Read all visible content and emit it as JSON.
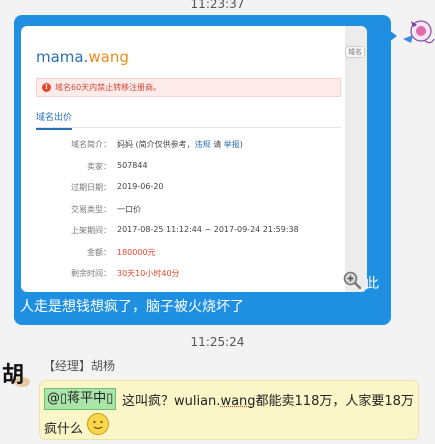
{
  "timestamps": [
    "11:23:37",
    "11:25:24"
  ],
  "message1": {
    "screenshot": {
      "brand_part1": "mama.",
      "brand_part2": "wang",
      "tab_stub": "域名",
      "warning": "域名60天内禁止转移注册商。",
      "subtab": "域名出价",
      "rows": [
        {
          "label": "域名简介：",
          "value": "妈妈 (简介仅供参考，",
          "link1": "违规",
          "mid": " 请 ",
          "link2": "举报",
          "end": ")"
        },
        {
          "label": "卖家：",
          "value": "507844"
        },
        {
          "label": "过期日期：",
          "value": "2019-06-20"
        },
        {
          "label": "交易类型：",
          "value": "一口价"
        },
        {
          "label": "上架期间：",
          "value": "2017-08-25 11:12:44 ~ 2017-09-24 21:59:38"
        },
        {
          "label": "金额：",
          "value": "180000元"
        },
        {
          "label": "剩余时间：",
          "value": "30天10小时40分"
        }
      ]
    },
    "caption_suffix": "此",
    "text": "人走是想钱想疯了，脑子被火烧坏了"
  },
  "message2": {
    "sender": "【经理】胡杨",
    "mention": "@▯蒋平中▯",
    "line1_a": "这叫疯？wulian.",
    "line1_b": "wang",
    "line1_c": "都能卖118万，人家要18万",
    "line2": "疯什么",
    "avatar_char": "胡"
  },
  "colors": {
    "bubble": "#1e8fe1",
    "received_bubble": "#fbf6c8",
    "mention_bg": "#a9e4a9"
  }
}
